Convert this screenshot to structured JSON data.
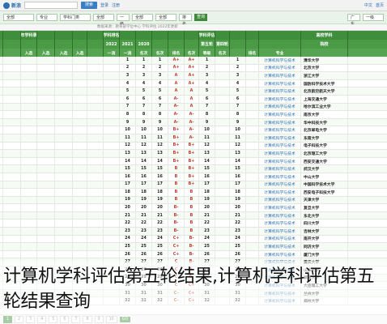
{
  "topbar": {
    "logo_text": "新浪",
    "search_button": "搜索",
    "links": [
      "登录",
      "注册"
    ],
    "right_links": [
      "中文",
      "首页"
    ]
  },
  "filterbar": {
    "selects": [
      "全部",
      "专业",
      "学科门类",
      "全部",
      "一级",
      "全部",
      "全部",
      "排名"
    ],
    "go_button": "查询",
    "right_selects": [
      "广东",
      "一级"
    ]
  },
  "subline": "数据来源：教育部学位中心  学科评估  2022年更新",
  "table": {
    "header1": [
      "",
      "近年学科录取",
      "",
      "",
      "",
      "",
      "学科排名",
      "",
      "",
      "",
      "",
      "",
      "学科评估",
      "",
      "",
      "",
      "",
      "高校学科"
    ],
    "header2": [
      "",
      "",
      "",
      "",
      "",
      "",
      "2022",
      "2021",
      "2020",
      "",
      "",
      "",
      "第五轮",
      "第四轮",
      "",
      "",
      "",
      "院校"
    ],
    "header3": [
      "",
      "入选",
      "入选",
      "入选",
      "入选",
      "",
      "一流",
      "一流",
      "名次",
      "名次",
      "排名",
      "名次",
      "等级",
      "名次",
      "",
      "排名",
      "专业",
      ""
    ],
    "rows": [
      {
        "rank": "1",
        "grade": "A+",
        "grade4": "A+",
        "sub": "1",
        "name": "清华大学",
        "major": "计算机科学与技术"
      },
      {
        "rank": "2",
        "grade": "A+",
        "grade4": "A+",
        "sub": "2",
        "name": "北京大学",
        "major": "计算机科学与技术"
      },
      {
        "rank": "3",
        "grade": "A+",
        "grade4": "A",
        "sub": "3",
        "name": "浙江大学",
        "major": "计算机科学与技术"
      },
      {
        "rank": "4",
        "grade": "A+",
        "grade4": "A",
        "sub": "4",
        "name": "国防科学技术大学",
        "major": "计算机科学与技术"
      },
      {
        "rank": "5",
        "grade": "A",
        "grade4": "A",
        "sub": "5",
        "name": "北京航空航天大学",
        "major": "计算机科学与技术"
      },
      {
        "rank": "6",
        "grade": "A",
        "grade4": "A-",
        "sub": "6",
        "name": "上海交通大学",
        "major": "计算机科学与技术"
      },
      {
        "rank": "7",
        "grade": "A",
        "grade4": "A-",
        "sub": "7",
        "name": "哈尔滨工业大学",
        "major": "计算机科学与技术"
      },
      {
        "rank": "8",
        "grade": "A-",
        "grade4": "A-",
        "sub": "8",
        "name": "南京大学",
        "major": "计算机科学与技术"
      },
      {
        "rank": "9",
        "grade": "A-",
        "grade4": "A-",
        "sub": "9",
        "name": "华中科技大学",
        "major": "计算机科学与技术"
      },
      {
        "rank": "10",
        "grade": "A-",
        "grade4": "B+",
        "sub": "10",
        "name": "北京邮电大学",
        "major": "计算机科学与技术"
      },
      {
        "rank": "11",
        "grade": "A-",
        "grade4": "B+",
        "sub": "11",
        "name": "东南大学",
        "major": "计算机科学与技术"
      },
      {
        "rank": "12",
        "grade": "B+",
        "grade4": "B+",
        "sub": "12",
        "name": "电子科技大学",
        "major": "计算机科学与技术"
      },
      {
        "rank": "13",
        "grade": "B+",
        "grade4": "B+",
        "sub": "13",
        "name": "北京理工大学",
        "major": "计算机科学与技术"
      },
      {
        "rank": "14",
        "grade": "B+",
        "grade4": "B+",
        "sub": "14",
        "name": "西安交通大学",
        "major": "计算机科学与技术"
      },
      {
        "rank": "15",
        "grade": "B+",
        "grade4": "B",
        "sub": "15",
        "name": "武汉大学",
        "major": "计算机科学与技术"
      },
      {
        "rank": "16",
        "grade": "B+",
        "grade4": "B",
        "sub": "16",
        "name": "中山大学",
        "major": "计算机科学与技术"
      },
      {
        "rank": "17",
        "grade": "B+",
        "grade4": "B",
        "sub": "17",
        "name": "中国科学技术大学",
        "major": "计算机科学与技术"
      },
      {
        "rank": "18",
        "grade": "B",
        "grade4": "B",
        "sub": "18",
        "name": "西安电子科技大学",
        "major": "计算机科学与技术"
      },
      {
        "rank": "19",
        "grade": "B",
        "grade4": "B",
        "sub": "19",
        "name": "天津大学",
        "major": "计算机科学与技术"
      },
      {
        "rank": "20",
        "grade": "B",
        "grade4": "B-",
        "sub": "20",
        "name": "复旦大学",
        "major": "计算机科学与技术"
      },
      {
        "rank": "21",
        "grade": "B",
        "grade4": "B-",
        "sub": "21",
        "name": "东北大学",
        "major": "计算机科学与技术"
      },
      {
        "rank": "22",
        "grade": "B",
        "grade4": "B-",
        "sub": "22",
        "name": "四川大学",
        "major": "计算机科学与技术"
      },
      {
        "rank": "23",
        "grade": "B",
        "grade4": "B-",
        "sub": "23",
        "name": "吉林大学",
        "major": "计算机科学与技术"
      },
      {
        "rank": "24",
        "grade": "B-",
        "grade4": "C+",
        "sub": "24",
        "name": "南开大学",
        "major": "计算机科学与技术"
      },
      {
        "rank": "25",
        "grade": "B-",
        "grade4": "C+",
        "sub": "25",
        "name": "同济大学",
        "major": "计算机科学与技术"
      },
      {
        "rank": "26",
        "grade": "B-",
        "grade4": "C+",
        "sub": "26",
        "name": "厦门大学",
        "major": "计算机科学与技术"
      },
      {
        "rank": "27",
        "grade": "B-",
        "grade4": "C",
        "sub": "27",
        "name": "重庆大学",
        "major": "计算机科学与技术"
      },
      {
        "rank": "28",
        "grade": "B-",
        "grade4": "C",
        "sub": "28",
        "name": "山东大学",
        "major": "计算机科学与技术"
      },
      {
        "rank": "29",
        "grade": "B-",
        "grade4": "C",
        "sub": "29",
        "name": "湖南大学",
        "major": "计算机科学与技术"
      },
      {
        "rank": "30",
        "grade": "C+",
        "grade4": "C",
        "sub": "30",
        "name": "大连理工大学",
        "major": "计算机科学与技术"
      },
      {
        "rank": "31",
        "grade": "C+",
        "grade4": "C-",
        "sub": "31",
        "name": "兰州大学",
        "major": "计算机科学与技术"
      },
      {
        "rank": "32",
        "grade": "C+",
        "grade4": "C-",
        "sub": "32",
        "name": "郑州大学",
        "major": "计算机科学与技术"
      }
    ]
  },
  "pager": {
    "pages": [
      "1",
      "2",
      "3",
      "4",
      "5",
      "6",
      "7",
      "8",
      "9",
      "10"
    ],
    "go_button": "GO"
  },
  "caption": "计算机学科评估第五轮结果,计算机学科评估第五轮结果查询"
}
